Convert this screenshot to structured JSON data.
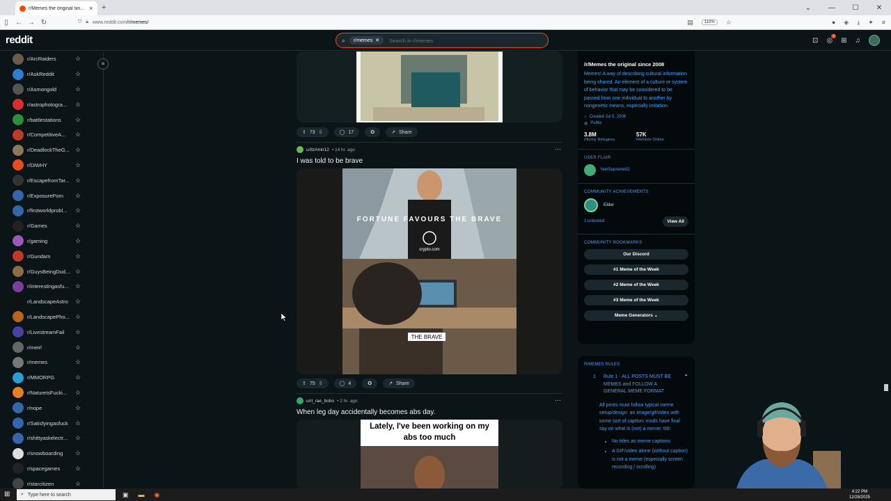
{
  "browser": {
    "tab_title": "r/Memes the original since 20",
    "url_domain": "www.reddit.com",
    "url_path": "/r/memes/",
    "zoom": "110%"
  },
  "header": {
    "logo": "reddit",
    "search_chip": "r/memes",
    "search_placeholder": "Search in r/memes",
    "notif_count": "1"
  },
  "sidebar": {
    "items": [
      {
        "label": "r/ArcRaiders",
        "color": "#6b5b4b"
      },
      {
        "label": "r/AskReddit",
        "color": "#2d7dd2"
      },
      {
        "label": "r/Asmongold",
        "color": "#555"
      },
      {
        "label": "r/astrophotogra...",
        "color": "#d62f2f"
      },
      {
        "label": "r/battlestations",
        "color": "#2a8f3a"
      },
      {
        "label": "r/CompetitiveA...",
        "color": "#c0392b"
      },
      {
        "label": "r/DeadlockTheG...",
        "color": "#8a7a5a"
      },
      {
        "label": "r/DiWHY",
        "color": "#e74c1c"
      },
      {
        "label": "r/EscapefromTar...",
        "color": "#333"
      },
      {
        "label": "r/ExposurePorn",
        "color": "#3366aa"
      },
      {
        "label": "r/firstworldprobl...",
        "color": "#3366aa"
      },
      {
        "label": "r/Games",
        "color": "#222"
      },
      {
        "label": "r/gaming",
        "color": "#9b59b6"
      },
      {
        "label": "r/Gundam",
        "color": "#c0392b"
      },
      {
        "label": "r/GuysBeingDud...",
        "color": "#8b6b4b"
      },
      {
        "label": "r/interestingasfu...",
        "color": "#7b3fa0"
      },
      {
        "label": "r/LandscapeAstro",
        "color": "#111"
      },
      {
        "label": "r/LandscapePho...",
        "color": "#b5651d"
      },
      {
        "label": "r/LivestreamFail",
        "color": "#4b3fa0"
      },
      {
        "label": "r/meirl",
        "color": "#666"
      },
      {
        "label": "r/memes",
        "color": "#777"
      },
      {
        "label": "r/MMORPG",
        "color": "#2a9fd6"
      },
      {
        "label": "r/NatureIsFucki...",
        "color": "#e67e22"
      },
      {
        "label": "r/nope",
        "color": "#3366aa"
      },
      {
        "label": "r/Satisfyingasfuck",
        "color": "#3366aa"
      },
      {
        "label": "r/shittyaskelectr...",
        "color": "#3366aa"
      },
      {
        "label": "r/snowboarding",
        "color": "#ddd"
      },
      {
        "label": "r/spacegames",
        "color": "#222"
      },
      {
        "label": "r/starcitizen",
        "color": "#444"
      }
    ]
  },
  "posts": [
    {
      "upvotes": "73",
      "comments": "17",
      "share": "Share"
    },
    {
      "user": "u/ItzAmir12",
      "time": "• 14 hr. ago",
      "title": "I was told to be brave",
      "caption_top": "FORTUNE FAVOURS THE BRAVE",
      "brand": "crypto.com",
      "caption_bottom": "THE BRAVE",
      "upvotes": "75",
      "comments": "4",
      "share": "Share"
    },
    {
      "user": "u/rl_rae_bobo",
      "time": "• 2 hr. ago",
      "title": "When leg day accidentally becomes abs day.",
      "caption": "Lately, I've been working on my abs too much"
    }
  ],
  "community": {
    "name": "/r/Memes the original since 2008",
    "description": "Memes! A way of describing cultural information being shared. An element of a culture or system of behavior that may be considered to be passed from one individual to another by nongenetic means, especially imitation.",
    "created": "Created Jul 5, 2008",
    "visibility": "Public",
    "members": "3.8M",
    "members_label": "r/funny Refugees",
    "online": "57K",
    "online_label": "Memists Online",
    "user_flair_heading": "USER FLAIR",
    "user_flair": "YeetSupreme92",
    "achievements_heading": "COMMUNITY ACHIEVEMENTS",
    "achievement": "Elder",
    "unlocked": "1 unlocked",
    "view_all": "View All",
    "bookmarks_heading": "COMMUNITY BOOKMARKS",
    "bookmarks": [
      "Our Discord",
      "#1 Meme of the Week",
      "#2 Meme of the Week",
      "#3 Meme of the Week",
      "Meme Generators"
    ]
  },
  "rules": {
    "heading": "R/MEMES RULES",
    "rule_num": "1",
    "rule_title": "Rule 1 - ALL POSTS MUST BE MEMES and FOLLOW A GENERAL MEME FORMAT",
    "rule_text": "All posts must follow typical meme setup/design: an image/gif/video with some sort of caption; mods have final say on what is (not) a meme; tldr:",
    "bullets": [
      "No titles as meme captions",
      "A GIF/video alone (without caption) is not a meme (especially screen recording / scrolling)"
    ]
  },
  "taskbar": {
    "search_placeholder": "Type here to search",
    "time": "4:22 PM",
    "date": "12/28/2025"
  }
}
